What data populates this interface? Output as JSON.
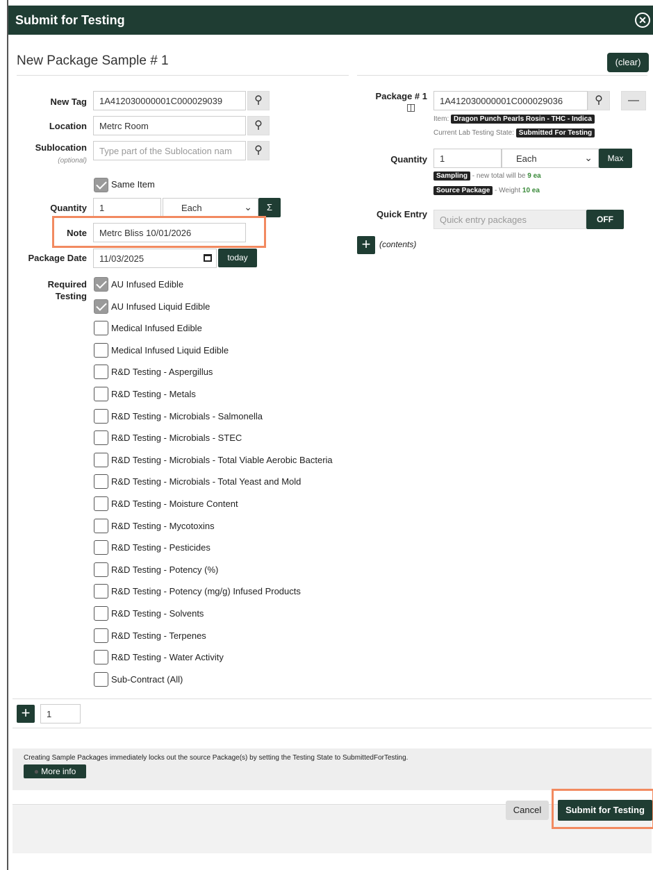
{
  "dialog": {
    "title": "Submit for Testing",
    "close_icon": "close-circle-icon"
  },
  "header": {
    "title": "New Package Sample # 1",
    "clear_label": "(clear)"
  },
  "form": {
    "new_tag_label": "New Tag",
    "new_tag_value": "1A412030000001C000029039",
    "location_label": "Location",
    "location_value": "Metrc Room",
    "sublocation_label": "Sublocation",
    "sublocation_optional": "(optional)",
    "sublocation_placeholder": "Type part of the Sublocation nam",
    "same_item_label": "Same Item",
    "quantity_label": "Quantity",
    "quantity_value": "1",
    "unit_value": "Each",
    "sum_label": "Σ",
    "note_label": "Note",
    "note_value": "Metrc Bliss 10/01/2026",
    "package_date_label": "Package Date",
    "package_date_value": "11/03/2025",
    "today_label": "today",
    "required_testing_label_1": "Required",
    "required_testing_label_2": "Testing"
  },
  "tests": [
    {
      "label": "AU Infused Edible",
      "checked": true
    },
    {
      "label": "AU Infused Liquid Edible",
      "checked": true
    },
    {
      "label": "Medical Infused Edible",
      "checked": false
    },
    {
      "label": "Medical Infused Liquid Edible",
      "checked": false
    },
    {
      "label": "R&D Testing - Aspergillus",
      "checked": false
    },
    {
      "label": "R&D Testing - Metals",
      "checked": false
    },
    {
      "label": "R&D Testing - Microbials - Salmonella",
      "checked": false
    },
    {
      "label": "R&D Testing - Microbials - STEC",
      "checked": false
    },
    {
      "label": "R&D Testing - Microbials - Total Viable Aerobic Bacteria",
      "checked": false
    },
    {
      "label": "R&D Testing - Microbials - Total Yeast and Mold",
      "checked": false
    },
    {
      "label": "R&D Testing - Moisture Content",
      "checked": false
    },
    {
      "label": "R&D Testing - Mycotoxins",
      "checked": false
    },
    {
      "label": "R&D Testing - Pesticides",
      "checked": false
    },
    {
      "label": "R&D Testing - Potency (%)",
      "checked": false
    },
    {
      "label": "R&D Testing - Potency (mg/g) Infused Products",
      "checked": false
    },
    {
      "label": "R&D Testing - Solvents",
      "checked": false
    },
    {
      "label": "R&D Testing - Terpenes",
      "checked": false
    },
    {
      "label": "R&D Testing - Water Activity",
      "checked": false
    },
    {
      "label": "Sub-Contract (All)",
      "checked": false
    }
  ],
  "package": {
    "label": "Package # 1",
    "value": "1A412030000001C000029036",
    "item_prefix": "Item:",
    "item_value": "Dragon Punch Pearls Rosin - THC - Indica",
    "state_prefix": "Current Lab Testing State:",
    "state_value": "Submitted For Testing",
    "quantity_label": "Quantity",
    "quantity_value": "1",
    "unit_value": "Each",
    "max_label": "Max",
    "sampling_tag": "Sampling",
    "sampling_text": "- new total will be",
    "sampling_value": "9 ea",
    "source_tag": "Source Package",
    "source_text": "- Weight",
    "source_value": "10 ea",
    "quick_entry_label": "Quick Entry",
    "quick_entry_placeholder": "Quick entry packages",
    "off_label": "OFF",
    "contents_label": "(contents)"
  },
  "footer": {
    "count_value": "1",
    "info_text": "Creating Sample Packages immediately locks out the source Package(s) by setting the Testing State to SubmittedForTesting.",
    "more_info_label": "More info",
    "cancel_label": "Cancel",
    "submit_label": "Submit for Testing"
  }
}
